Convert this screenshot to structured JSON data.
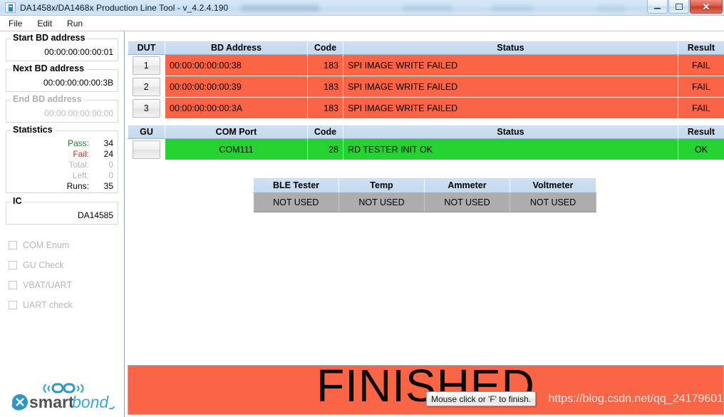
{
  "window": {
    "title": "DA1458x/DA1468x Production Line Tool - v_4.2.4.190",
    "app_icon": "app-icon",
    "buttons": {
      "minimize": "minimize-icon",
      "maximize": "maximize-icon",
      "close": "✕"
    }
  },
  "menu": {
    "items": [
      {
        "label": "File"
      },
      {
        "label": "Edit"
      },
      {
        "label": "Run"
      }
    ]
  },
  "sidebar": {
    "start_bd": {
      "title": "Start BD address",
      "value": "00:00:00:00:00:01"
    },
    "next_bd": {
      "title": "Next BD address",
      "value": "00:00:00:00:00:3B"
    },
    "end_bd": {
      "title": "End BD address",
      "value": "00:00:00:00:00:00"
    },
    "statistics": {
      "title": "Statistics",
      "rows": [
        {
          "label": "Pass:",
          "value": "34"
        },
        {
          "label": "Fail:",
          "value": "24"
        },
        {
          "label": "Total:",
          "value": "0"
        },
        {
          "label": "Left:",
          "value": "0"
        },
        {
          "label": "Runs:",
          "value": "35"
        }
      ]
    },
    "ic": {
      "title": "IC",
      "value": "DA14585"
    },
    "checks": [
      {
        "label": "COM Enum"
      },
      {
        "label": "GU Check"
      },
      {
        "label": "VBAT/UART"
      },
      {
        "label": "UART check"
      }
    ],
    "logo": {
      "text_bold": "smart",
      "text_italic": "bond"
    }
  },
  "dut_table": {
    "headers": [
      "DUT",
      "BD Address",
      "Code",
      "Status",
      "Result"
    ],
    "rows": [
      {
        "dut": "1",
        "address": "00:00:00:00:00:38",
        "code": "183",
        "status": "SPI IMAGE WRITE FAILED",
        "result": "FAIL"
      },
      {
        "dut": "2",
        "address": "00:00:00:00:00:39",
        "code": "183",
        "status": "SPI IMAGE WRITE FAILED",
        "result": "FAIL"
      },
      {
        "dut": "3",
        "address": "00:00:00:00:00:3A",
        "code": "183",
        "status": "SPI IMAGE WRITE FAILED",
        "result": "FAIL"
      }
    ]
  },
  "gu_table": {
    "headers": [
      "GU",
      "COM Port",
      "Code",
      "Status",
      "Result"
    ],
    "rows": [
      {
        "gu": "",
        "com_port": "COM111",
        "code": "28",
        "status": "RD TESTER INIT OK",
        "result": "OK"
      }
    ]
  },
  "equipment_table": {
    "headers": [
      "BLE Tester",
      "Temp",
      "Ammeter",
      "Voltmeter"
    ],
    "values": [
      "NOT USED",
      "NOT USED",
      "NOT USED",
      "NOT USED"
    ]
  },
  "banner": {
    "text": "FINISHED",
    "watermark": "https://blog.csdn.net/qq_24179601"
  },
  "tooltip": {
    "text": "Mouse click or 'F' to finish."
  },
  "colors": {
    "fail_row": "#fb6445",
    "ok_row": "#24d331",
    "header": "#c3d8ed",
    "not_used": "#adadad",
    "pass_label": "#1f7a2e",
    "fail_label": "#cc2a1f"
  }
}
